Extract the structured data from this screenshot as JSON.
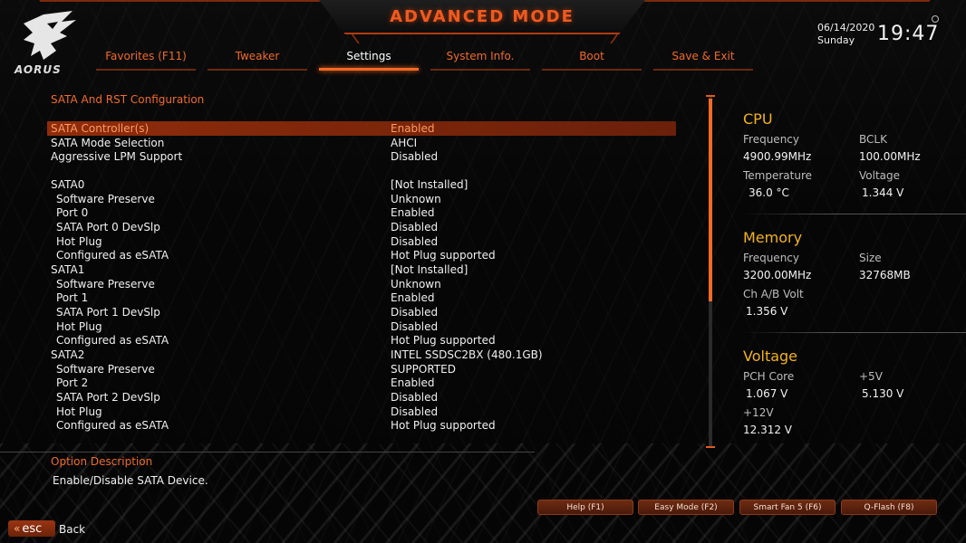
{
  "header": {
    "title": "ADVANCED MODE",
    "logo_text": "AORUS",
    "date": "06/14/2020",
    "day": "Sunday",
    "time": "19:47",
    "tabs": [
      {
        "label": "Favorites (F11)",
        "active": false
      },
      {
        "label": "Tweaker",
        "active": false
      },
      {
        "label": "Settings",
        "active": true
      },
      {
        "label": "System Info.",
        "active": false
      },
      {
        "label": "Boot",
        "active": false
      },
      {
        "label": "Save & Exit",
        "active": false
      }
    ]
  },
  "main": {
    "section_title": "SATA And RST Configuration",
    "rows": [
      {
        "label": "SATA Controller(s)",
        "value": "Enabled",
        "sub": false,
        "selected": true
      },
      {
        "label": "SATA Mode Selection",
        "value": "AHCI",
        "sub": false,
        "selected": false
      },
      {
        "label": "Aggressive LPM Support",
        "value": "Disabled",
        "sub": false,
        "selected": false
      },
      {
        "label": "SATA0",
        "value": "[Not Installed]",
        "sub": false,
        "selected": false
      },
      {
        "label": "Software Preserve",
        "value": "Unknown",
        "sub": true,
        "selected": false
      },
      {
        "label": "Port 0",
        "value": "Enabled",
        "sub": true,
        "selected": false
      },
      {
        "label": "SATA Port 0 DevSlp",
        "value": "Disabled",
        "sub": true,
        "selected": false
      },
      {
        "label": "Hot Plug",
        "value": "Disabled",
        "sub": true,
        "selected": false
      },
      {
        "label": "Configured as eSATA",
        "value": "Hot Plug supported",
        "sub": true,
        "selected": false
      },
      {
        "label": "SATA1",
        "value": "[Not Installed]",
        "sub": false,
        "selected": false
      },
      {
        "label": "Software Preserve",
        "value": "Unknown",
        "sub": true,
        "selected": false
      },
      {
        "label": "Port 1",
        "value": "Enabled",
        "sub": true,
        "selected": false
      },
      {
        "label": "SATA Port 1 DevSlp",
        "value": "Disabled",
        "sub": true,
        "selected": false
      },
      {
        "label": "Hot Plug",
        "value": "Disabled",
        "sub": true,
        "selected": false
      },
      {
        "label": "Configured as eSATA",
        "value": "Hot Plug supported",
        "sub": true,
        "selected": false
      },
      {
        "label": "SATA2",
        "value": "INTEL SSDSC2BX (480.1GB)",
        "sub": false,
        "selected": false
      },
      {
        "label": "Software Preserve",
        "value": "SUPPORTED",
        "sub": true,
        "selected": false
      },
      {
        "label": "Port 2",
        "value": "Enabled",
        "sub": true,
        "selected": false
      },
      {
        "label": "SATA Port 2 DevSlp",
        "value": "Disabled",
        "sub": true,
        "selected": false
      },
      {
        "label": "Hot Plug",
        "value": "Disabled",
        "sub": true,
        "selected": false
      },
      {
        "label": "Configured as eSATA",
        "value": "Hot Plug supported",
        "sub": true,
        "selected": false
      }
    ],
    "scroll_fraction_visible": 0.58
  },
  "panel": {
    "cpu": {
      "title": "CPU",
      "freq_label": "Frequency",
      "freq_value": "4900.99MHz",
      "bclk_label": "BCLK",
      "bclk_value": "100.00MHz",
      "temp_label": "Temperature",
      "temp_value": "36.0 °C",
      "volt_label": "Voltage",
      "volt_value": "1.344 V"
    },
    "memory": {
      "title": "Memory",
      "freq_label": "Frequency",
      "freq_value": "3200.00MHz",
      "size_label": "Size",
      "size_value": "32768MB",
      "chab_label": "Ch A/B Volt",
      "chab_value": "1.356 V"
    },
    "voltage": {
      "title": "Voltage",
      "pch_label": "PCH Core",
      "pch_value": "1.067 V",
      "v5_label": "+5V",
      "v5_value": "5.130 V",
      "v12_label": "+12V",
      "v12_value": "12.312 V"
    }
  },
  "description": {
    "title": "Option Description",
    "text": "Enable/Disable SATA Device."
  },
  "footer": {
    "buttons": [
      "Help (F1)",
      "Easy Mode (F2)",
      "Smart Fan 5 (F6)",
      "Q-Flash (F8)"
    ],
    "esc_label": "esc",
    "back_label": "Back"
  },
  "colors": {
    "accent": "#f26a22",
    "panel_title": "#f3b21d",
    "selected_row": "#8f2c0b"
  }
}
